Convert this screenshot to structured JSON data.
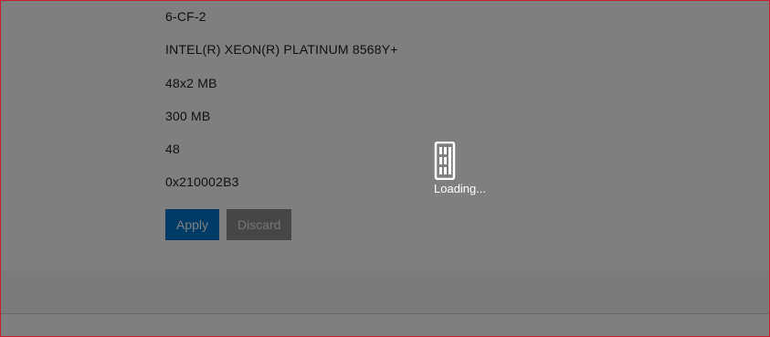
{
  "details": {
    "rows": [
      "6-CF-2",
      "INTEL(R) XEON(R) PLATINUM 8568Y+",
      "48x2 MB",
      "300 MB",
      "48",
      "0x210002B3"
    ]
  },
  "actions": {
    "apply_label": "Apply",
    "discard_label": "Discard"
  },
  "loading": {
    "icon": "server-icon",
    "text": "Loading..."
  },
  "colors": {
    "accent": "#0076ce",
    "frame_border": "#c81d2a",
    "overlay": "rgba(0,0,0,0.5)"
  }
}
